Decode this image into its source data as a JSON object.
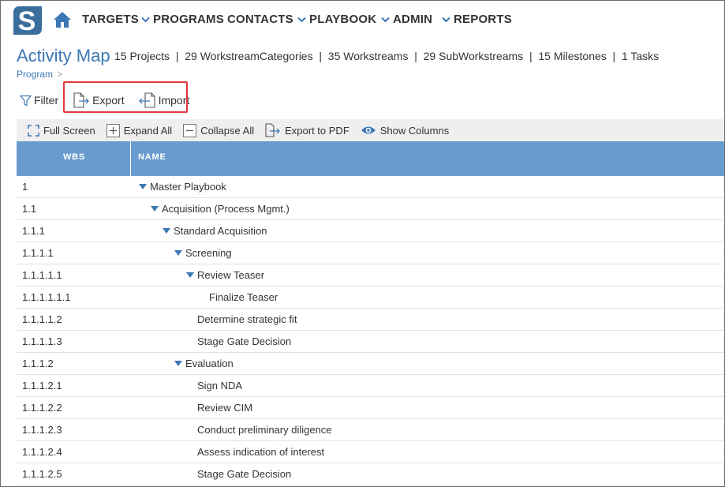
{
  "nav": {
    "items": [
      {
        "label": "TARGETS",
        "chevron": false
      },
      {
        "label": "PROGRAMS",
        "chevron": true
      },
      {
        "label": "CONTACTS",
        "chevron": false
      },
      {
        "label": "PLAYBOOK",
        "chevron": true
      },
      {
        "label": "ADMIN",
        "chevron": true
      },
      {
        "label": "REPORTS",
        "chevron": true
      }
    ],
    "logo_letter": "S"
  },
  "header": {
    "title": "Activity Map",
    "stats": "15 Projects  |  29 WorkstreamCategories  |  35 Workstreams  |  29 SubWorkstreams  |  15 Milestones  |  1 Tasks",
    "breadcrumb": "Program",
    "breadcrumb_sep": ">"
  },
  "toolbar": {
    "filter": "Filter",
    "export": "Export",
    "import": "Import"
  },
  "grid_toolbar": {
    "full_screen": "Full Screen",
    "expand_all": "Expand All",
    "collapse_all": "Collapse All",
    "export_pdf": "Export to PDF",
    "show_columns": "Show Columns"
  },
  "grid": {
    "columns": [
      "WBS",
      "NAME"
    ],
    "rows": [
      {
        "wbs": "1",
        "name": "Master Playbook",
        "level": 0,
        "expanded": true
      },
      {
        "wbs": "1.1",
        "name": "Acquisition (Process Mgmt.)",
        "level": 1,
        "expanded": true
      },
      {
        "wbs": "1.1.1",
        "name": "Standard Acquisition",
        "level": 2,
        "expanded": true
      },
      {
        "wbs": "1.1.1.1",
        "name": "Screening",
        "level": 3,
        "expanded": true
      },
      {
        "wbs": "1.1.1.1.1",
        "name": "Review Teaser",
        "level": 4,
        "expanded": true
      },
      {
        "wbs": "1.1.1.1.1.1",
        "name": "Finalize Teaser",
        "level": 5,
        "expanded": false
      },
      {
        "wbs": "1.1.1.1.2",
        "name": "Determine strategic fit",
        "level": 4,
        "expanded": false
      },
      {
        "wbs": "1.1.1.1.3",
        "name": "Stage Gate Decision",
        "level": 4,
        "expanded": false
      },
      {
        "wbs": "1.1.1.2",
        "name": "Evaluation",
        "level": 3,
        "expanded": true
      },
      {
        "wbs": "1.1.1.2.1",
        "name": "Sign NDA",
        "level": 4,
        "expanded": false
      },
      {
        "wbs": "1.1.1.2.2",
        "name": "Review CIM",
        "level": 4,
        "expanded": false
      },
      {
        "wbs": "1.1.1.2.3",
        "name": "Conduct preliminary diligence",
        "level": 4,
        "expanded": false
      },
      {
        "wbs": "1.1.1.2.4",
        "name": "Assess indication of interest",
        "level": 4,
        "expanded": false
      },
      {
        "wbs": "1.1.1.2.5",
        "name": "Stage Gate Decision",
        "level": 4,
        "expanded": false
      }
    ]
  },
  "colors": {
    "accent": "#3c78b5",
    "grid_header": "#6a9bcf",
    "highlight": "#e0393e",
    "logo": "#3a6e9c"
  },
  "icons": [
    "logo-icon",
    "home-icon",
    "chevron-down-icon",
    "filter-icon",
    "export-icon",
    "import-icon",
    "fullscreen-icon",
    "plus-box-icon",
    "minus-box-icon",
    "export-pdf-icon",
    "eye-icon",
    "caret-down-icon"
  ]
}
